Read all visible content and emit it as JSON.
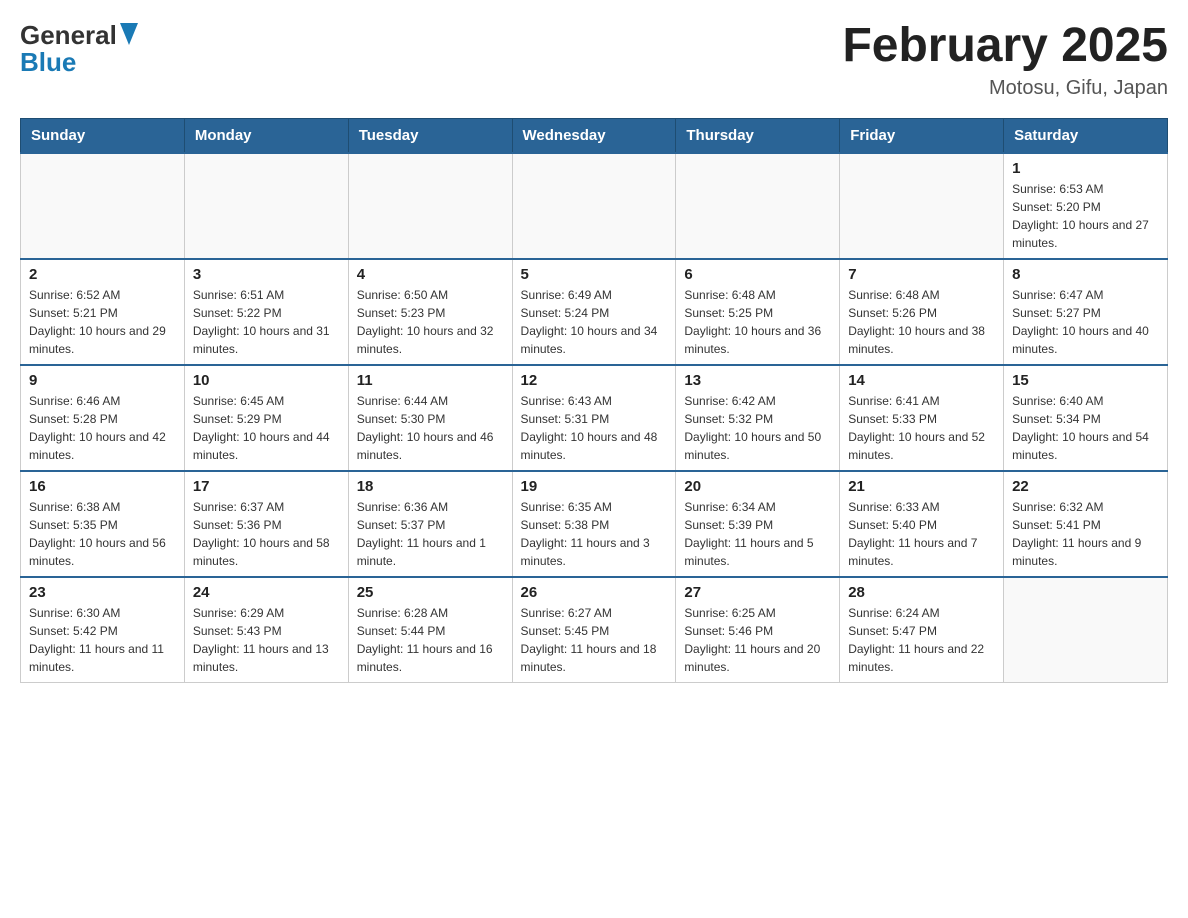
{
  "header": {
    "logo_general": "General",
    "logo_blue": "Blue",
    "month_title": "February 2025",
    "location": "Motosu, Gifu, Japan"
  },
  "days_of_week": [
    "Sunday",
    "Monday",
    "Tuesday",
    "Wednesday",
    "Thursday",
    "Friday",
    "Saturday"
  ],
  "weeks": [
    {
      "days": [
        {
          "num": "",
          "info": ""
        },
        {
          "num": "",
          "info": ""
        },
        {
          "num": "",
          "info": ""
        },
        {
          "num": "",
          "info": ""
        },
        {
          "num": "",
          "info": ""
        },
        {
          "num": "",
          "info": ""
        },
        {
          "num": "1",
          "info": "Sunrise: 6:53 AM\nSunset: 5:20 PM\nDaylight: 10 hours and 27 minutes."
        }
      ]
    },
    {
      "days": [
        {
          "num": "2",
          "info": "Sunrise: 6:52 AM\nSunset: 5:21 PM\nDaylight: 10 hours and 29 minutes."
        },
        {
          "num": "3",
          "info": "Sunrise: 6:51 AM\nSunset: 5:22 PM\nDaylight: 10 hours and 31 minutes."
        },
        {
          "num": "4",
          "info": "Sunrise: 6:50 AM\nSunset: 5:23 PM\nDaylight: 10 hours and 32 minutes."
        },
        {
          "num": "5",
          "info": "Sunrise: 6:49 AM\nSunset: 5:24 PM\nDaylight: 10 hours and 34 minutes."
        },
        {
          "num": "6",
          "info": "Sunrise: 6:48 AM\nSunset: 5:25 PM\nDaylight: 10 hours and 36 minutes."
        },
        {
          "num": "7",
          "info": "Sunrise: 6:48 AM\nSunset: 5:26 PM\nDaylight: 10 hours and 38 minutes."
        },
        {
          "num": "8",
          "info": "Sunrise: 6:47 AM\nSunset: 5:27 PM\nDaylight: 10 hours and 40 minutes."
        }
      ]
    },
    {
      "days": [
        {
          "num": "9",
          "info": "Sunrise: 6:46 AM\nSunset: 5:28 PM\nDaylight: 10 hours and 42 minutes."
        },
        {
          "num": "10",
          "info": "Sunrise: 6:45 AM\nSunset: 5:29 PM\nDaylight: 10 hours and 44 minutes."
        },
        {
          "num": "11",
          "info": "Sunrise: 6:44 AM\nSunset: 5:30 PM\nDaylight: 10 hours and 46 minutes."
        },
        {
          "num": "12",
          "info": "Sunrise: 6:43 AM\nSunset: 5:31 PM\nDaylight: 10 hours and 48 minutes."
        },
        {
          "num": "13",
          "info": "Sunrise: 6:42 AM\nSunset: 5:32 PM\nDaylight: 10 hours and 50 minutes."
        },
        {
          "num": "14",
          "info": "Sunrise: 6:41 AM\nSunset: 5:33 PM\nDaylight: 10 hours and 52 minutes."
        },
        {
          "num": "15",
          "info": "Sunrise: 6:40 AM\nSunset: 5:34 PM\nDaylight: 10 hours and 54 minutes."
        }
      ]
    },
    {
      "days": [
        {
          "num": "16",
          "info": "Sunrise: 6:38 AM\nSunset: 5:35 PM\nDaylight: 10 hours and 56 minutes."
        },
        {
          "num": "17",
          "info": "Sunrise: 6:37 AM\nSunset: 5:36 PM\nDaylight: 10 hours and 58 minutes."
        },
        {
          "num": "18",
          "info": "Sunrise: 6:36 AM\nSunset: 5:37 PM\nDaylight: 11 hours and 1 minute."
        },
        {
          "num": "19",
          "info": "Sunrise: 6:35 AM\nSunset: 5:38 PM\nDaylight: 11 hours and 3 minutes."
        },
        {
          "num": "20",
          "info": "Sunrise: 6:34 AM\nSunset: 5:39 PM\nDaylight: 11 hours and 5 minutes."
        },
        {
          "num": "21",
          "info": "Sunrise: 6:33 AM\nSunset: 5:40 PM\nDaylight: 11 hours and 7 minutes."
        },
        {
          "num": "22",
          "info": "Sunrise: 6:32 AM\nSunset: 5:41 PM\nDaylight: 11 hours and 9 minutes."
        }
      ]
    },
    {
      "days": [
        {
          "num": "23",
          "info": "Sunrise: 6:30 AM\nSunset: 5:42 PM\nDaylight: 11 hours and 11 minutes."
        },
        {
          "num": "24",
          "info": "Sunrise: 6:29 AM\nSunset: 5:43 PM\nDaylight: 11 hours and 13 minutes."
        },
        {
          "num": "25",
          "info": "Sunrise: 6:28 AM\nSunset: 5:44 PM\nDaylight: 11 hours and 16 minutes."
        },
        {
          "num": "26",
          "info": "Sunrise: 6:27 AM\nSunset: 5:45 PM\nDaylight: 11 hours and 18 minutes."
        },
        {
          "num": "27",
          "info": "Sunrise: 6:25 AM\nSunset: 5:46 PM\nDaylight: 11 hours and 20 minutes."
        },
        {
          "num": "28",
          "info": "Sunrise: 6:24 AM\nSunset: 5:47 PM\nDaylight: 11 hours and 22 minutes."
        },
        {
          "num": "",
          "info": ""
        }
      ]
    }
  ]
}
